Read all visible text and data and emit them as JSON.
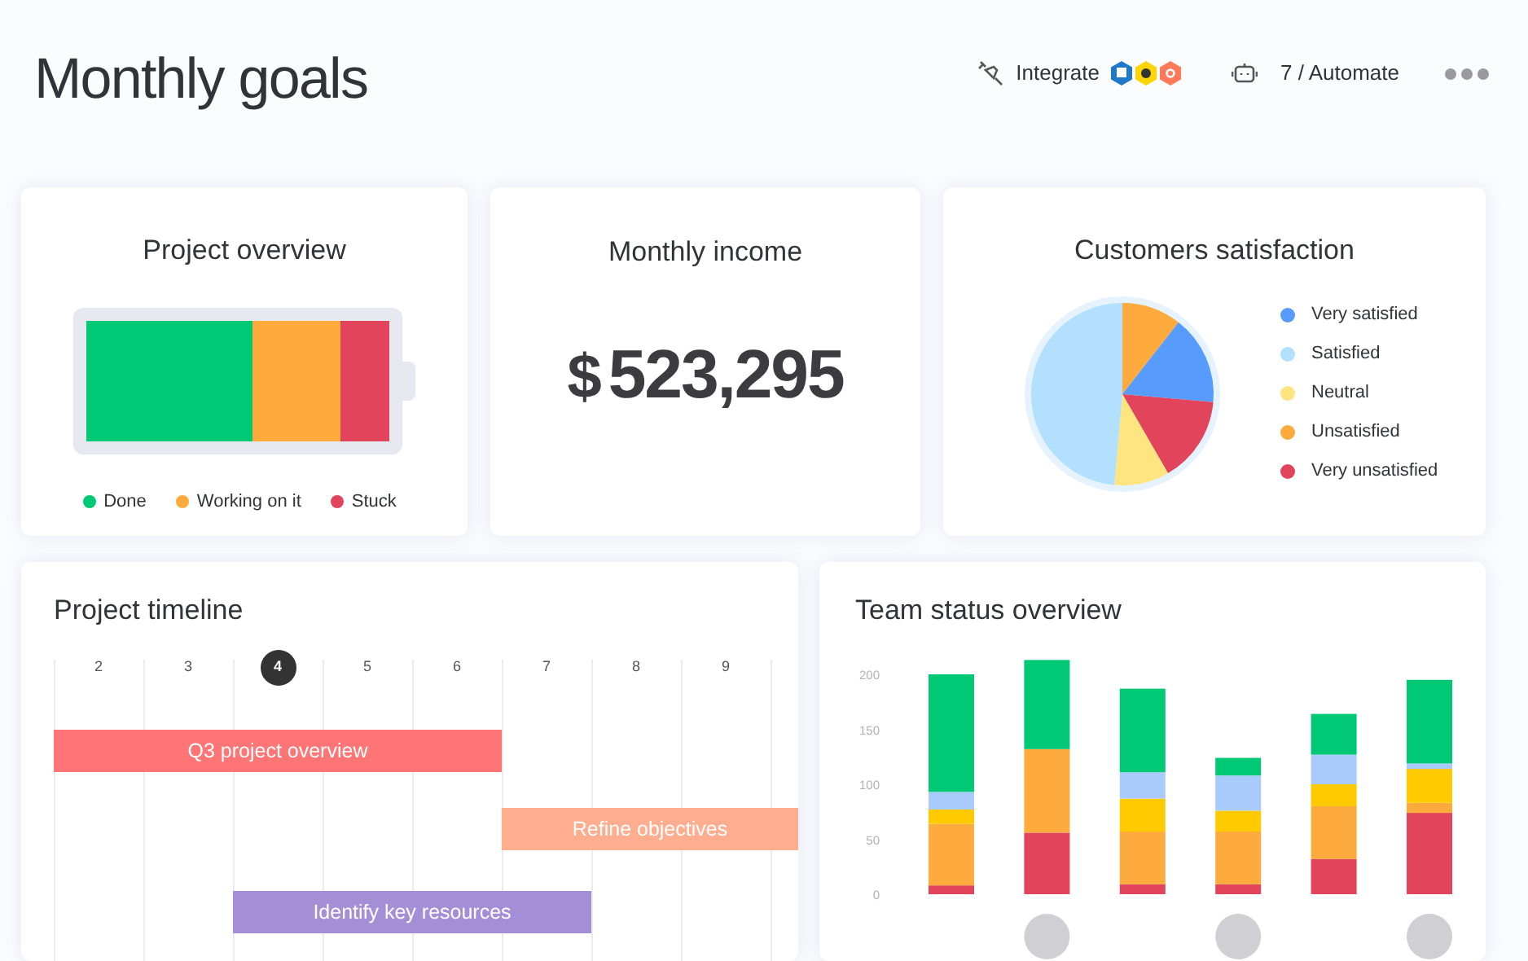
{
  "header": {
    "title": "Monthly goals",
    "integrate_label": "Integrate",
    "automate_label": "7 / Automate"
  },
  "project_overview": {
    "title": "Project overview",
    "segments": [
      {
        "label": "Done",
        "color": "#00c875"
      },
      {
        "label": "Working on it",
        "color": "#fdab3d"
      },
      {
        "label": "Stuck",
        "color": "#e2445c"
      }
    ]
  },
  "monthly_income": {
    "title": "Monthly income",
    "currency": "$",
    "amount": "523,295"
  },
  "customers_satisfaction": {
    "title": "Customers satisfaction",
    "legend": [
      {
        "label": "Very satisfied",
        "color": "#579bfc"
      },
      {
        "label": "Satisfied",
        "color": "#b3e0fe"
      },
      {
        "label": "Neutral",
        "color": "#ffe580"
      },
      {
        "label": "Unsatisfied",
        "color": "#fdab3d"
      },
      {
        "label": "Very unsatisfied",
        "color": "#e2445c"
      }
    ]
  },
  "project_timeline": {
    "title": "Project timeline",
    "columns": [
      {
        "label": "2",
        "selected": false
      },
      {
        "label": "3",
        "selected": false
      },
      {
        "label": "4",
        "selected": true
      },
      {
        "label": "5",
        "selected": false
      },
      {
        "label": "6",
        "selected": false
      },
      {
        "label": "7",
        "selected": false
      },
      {
        "label": "8",
        "selected": false
      },
      {
        "label": "9",
        "selected": false
      }
    ],
    "tasks": [
      {
        "label": "Q3 project overview",
        "color": "#ff7575"
      },
      {
        "label": "Refine objectives",
        "color": "#ffad8f"
      },
      {
        "label": "Identify key resources",
        "color": "#a48fd6"
      }
    ]
  },
  "team_status": {
    "title": "Team status overview",
    "chart_data": {
      "type": "bar",
      "stacked": true,
      "ylim": [
        0,
        220
      ],
      "yticks": [
        0,
        50,
        100,
        150,
        200
      ],
      "series": [
        {
          "color": "#e2445c",
          "values": [
            8,
            56,
            9,
            9,
            32,
            74
          ]
        },
        {
          "color": "#fdab3d",
          "values": [
            56,
            76,
            48,
            48,
            48,
            9
          ]
        },
        {
          "color": "#ffcb00",
          "values": [
            13,
            0,
            30,
            19,
            20,
            31
          ]
        },
        {
          "color": "#a9cbfb",
          "values": [
            16,
            0,
            24,
            32,
            27,
            5
          ]
        },
        {
          "color": "#00c875",
          "values": [
            107,
            81,
            76,
            16,
            37,
            76
          ]
        }
      ]
    }
  }
}
